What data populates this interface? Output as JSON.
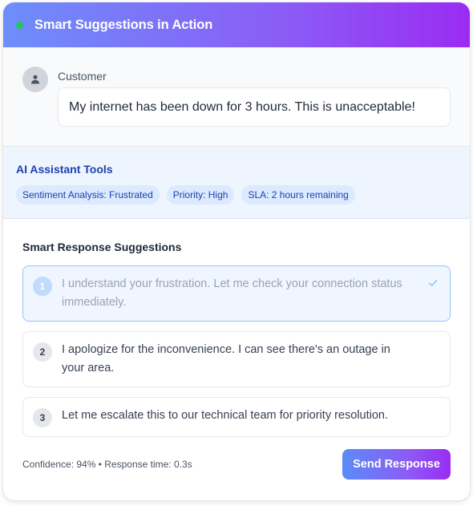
{
  "header": {
    "title": "Smart Suggestions in Action",
    "status_color": "#22c55e"
  },
  "customer": {
    "label": "Customer",
    "avatar_icon": "user-icon",
    "message": "My internet has been down for 3 hours. This is unacceptable!"
  },
  "tools": {
    "title": "AI Assistant Tools",
    "chips": [
      "Sentiment Analysis: Frustrated",
      "Priority: High",
      "SLA: 2 hours remaining"
    ]
  },
  "suggestions": {
    "title": "Smart Response Suggestions",
    "items": [
      {
        "number": "1",
        "text": "I understand your frustration. Let me check your connection status immediately.",
        "selected": true
      },
      {
        "number": "2",
        "text": "I apologize for the inconvenience. I can see there's an outage in your area.",
        "selected": false
      },
      {
        "number": "3",
        "text": "Let me escalate this to our technical team for priority resolution.",
        "selected": false
      }
    ]
  },
  "footer": {
    "meta": "Confidence: 94% • Response time: 0.3s",
    "send_label": "Send Response"
  },
  "colors": {
    "accent_start": "#5b8cf7",
    "accent_end": "#9a2cf2",
    "tool_text": "#1e40af"
  }
}
